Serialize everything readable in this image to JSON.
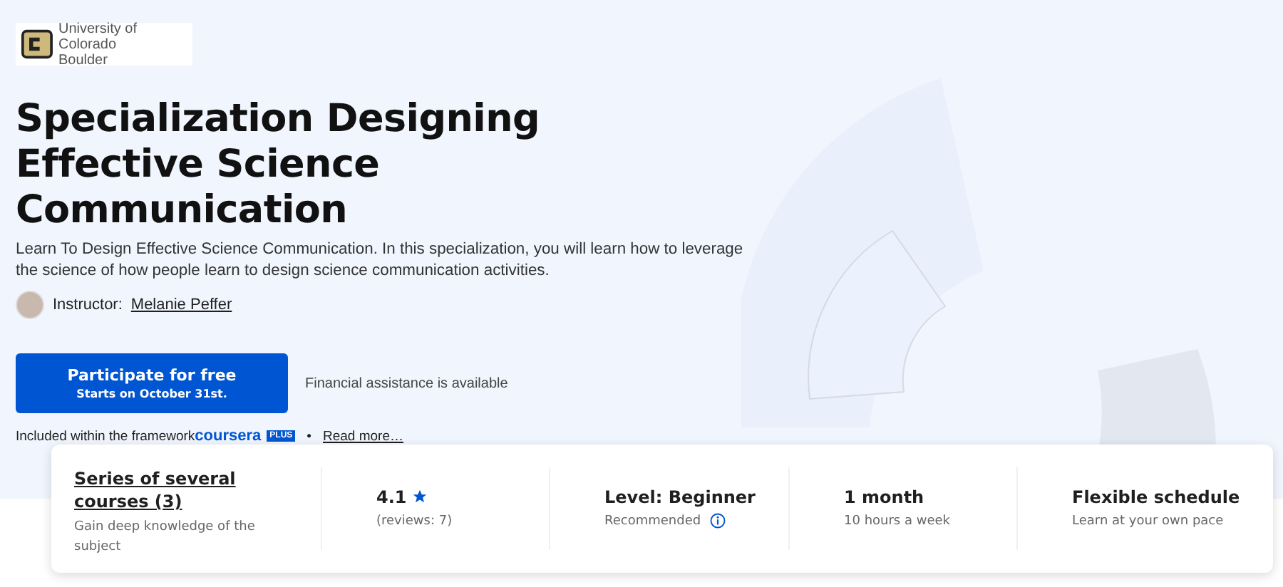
{
  "logo": {
    "line_1": "University of Colorado",
    "line_2": "Boulder"
  },
  "title": "Specialization Designing Effective Science Communication",
  "description": "Learn To Design Effective Science Communication. In this specialization, you will learn how to leverage the science of how people learn to design science communication activities.",
  "instructor": {
    "label": "Instructor:",
    "name": "Melanie Peffer"
  },
  "enroll_button": {
    "label": "Participate for free",
    "sublabel": "Starts on October 31st."
  },
  "financial_aid": "Financial assistance is available",
  "included": {
    "text": "Included within the framework",
    "brand": "coursera",
    "badge": "PLUS",
    "separator": "•",
    "link": "Read more…"
  },
  "stats": [
    {
      "kind": "link",
      "title": "Series of several courses (3)",
      "subtitle": "Gain deep knowledge of the subject"
    },
    {
      "kind": "rating",
      "title": "4.1",
      "subtitle": "(reviews: 7)"
    },
    {
      "kind": "info",
      "title": "Level: Beginner",
      "subtitle": "Recommended"
    },
    {
      "kind": "plain",
      "title": "1 month",
      "subtitle": "10 hours a week"
    },
    {
      "kind": "plain",
      "title": "Flexible schedule",
      "subtitle": "Learn at your own pace"
    }
  ]
}
